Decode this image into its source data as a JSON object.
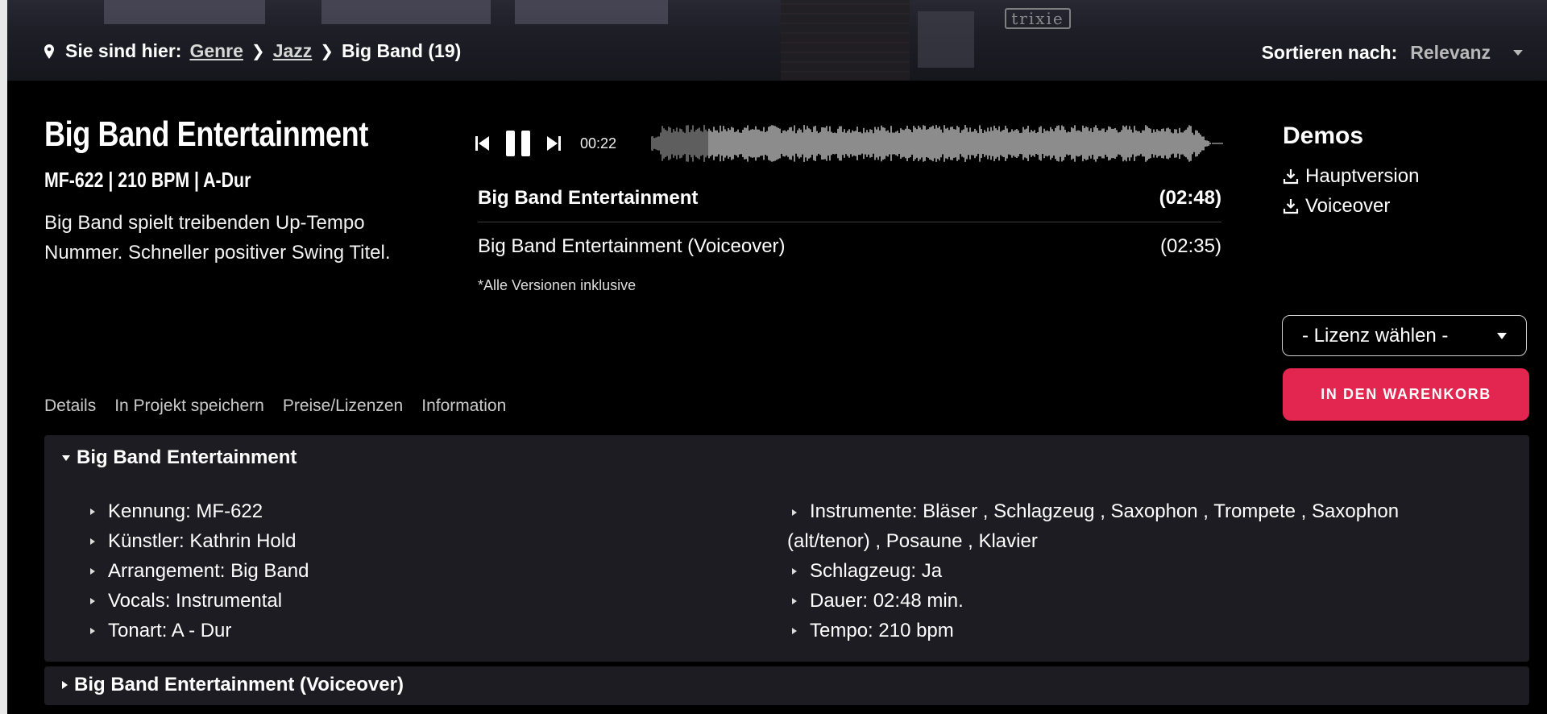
{
  "breadcrumb": {
    "prefix": "Sie sind hier:",
    "genre": "Genre",
    "jazz": "Jazz",
    "current": "Big Band (19)"
  },
  "sort": {
    "label": "Sortieren nach:",
    "value": "Relevanz"
  },
  "hero": {
    "sign_text": "trixie"
  },
  "track": {
    "title": "Big Band Entertainment",
    "meta": "MF-622 | 210 BPM | A-Dur",
    "description": "Big Band spielt treibenden Up-Tempo Nummer. Schneller positiver Swing Titel."
  },
  "player": {
    "time": "00:22",
    "progress": 0.1,
    "versions": [
      {
        "title": "Big Band Entertainment",
        "duration": "(02:48)"
      },
      {
        "title": "Big Band Entertainment (Voiceover)",
        "duration": "(02:35)"
      }
    ],
    "note": "*Alle Versionen inklusive"
  },
  "demos": {
    "title": "Demos",
    "items": [
      "Hauptversion",
      "Voiceover"
    ]
  },
  "license": {
    "placeholder": "- Lizenz wählen -"
  },
  "cart_button": "IN DEN WARENKORB",
  "tabs": [
    "Details",
    "In Projekt speichern",
    "Preise/Lizenzen",
    "Information"
  ],
  "details": {
    "main_title": "Big Band Entertainment",
    "left": [
      "Kennung: MF-622",
      "Künstler: Kathrin Hold",
      "Arrangement: Big Band",
      "Vocals: Instrumental",
      "Tonart: A - Dur"
    ],
    "right_wrapped": "Instrumente: Bläser , Schlagzeug , Saxophon , Trompete , Saxophon (alt/tenor) , Posaune , Klavier",
    "right": [
      "Schlagzeug: Ja",
      "Dauer: 02:48 min.",
      "Tempo: 210 bpm"
    ],
    "voiceover_title": "Big Band Entertainment (Voiceover)"
  },
  "colors": {
    "accent": "#e3264f",
    "panel": "#1c1c22",
    "background": "#000000"
  }
}
